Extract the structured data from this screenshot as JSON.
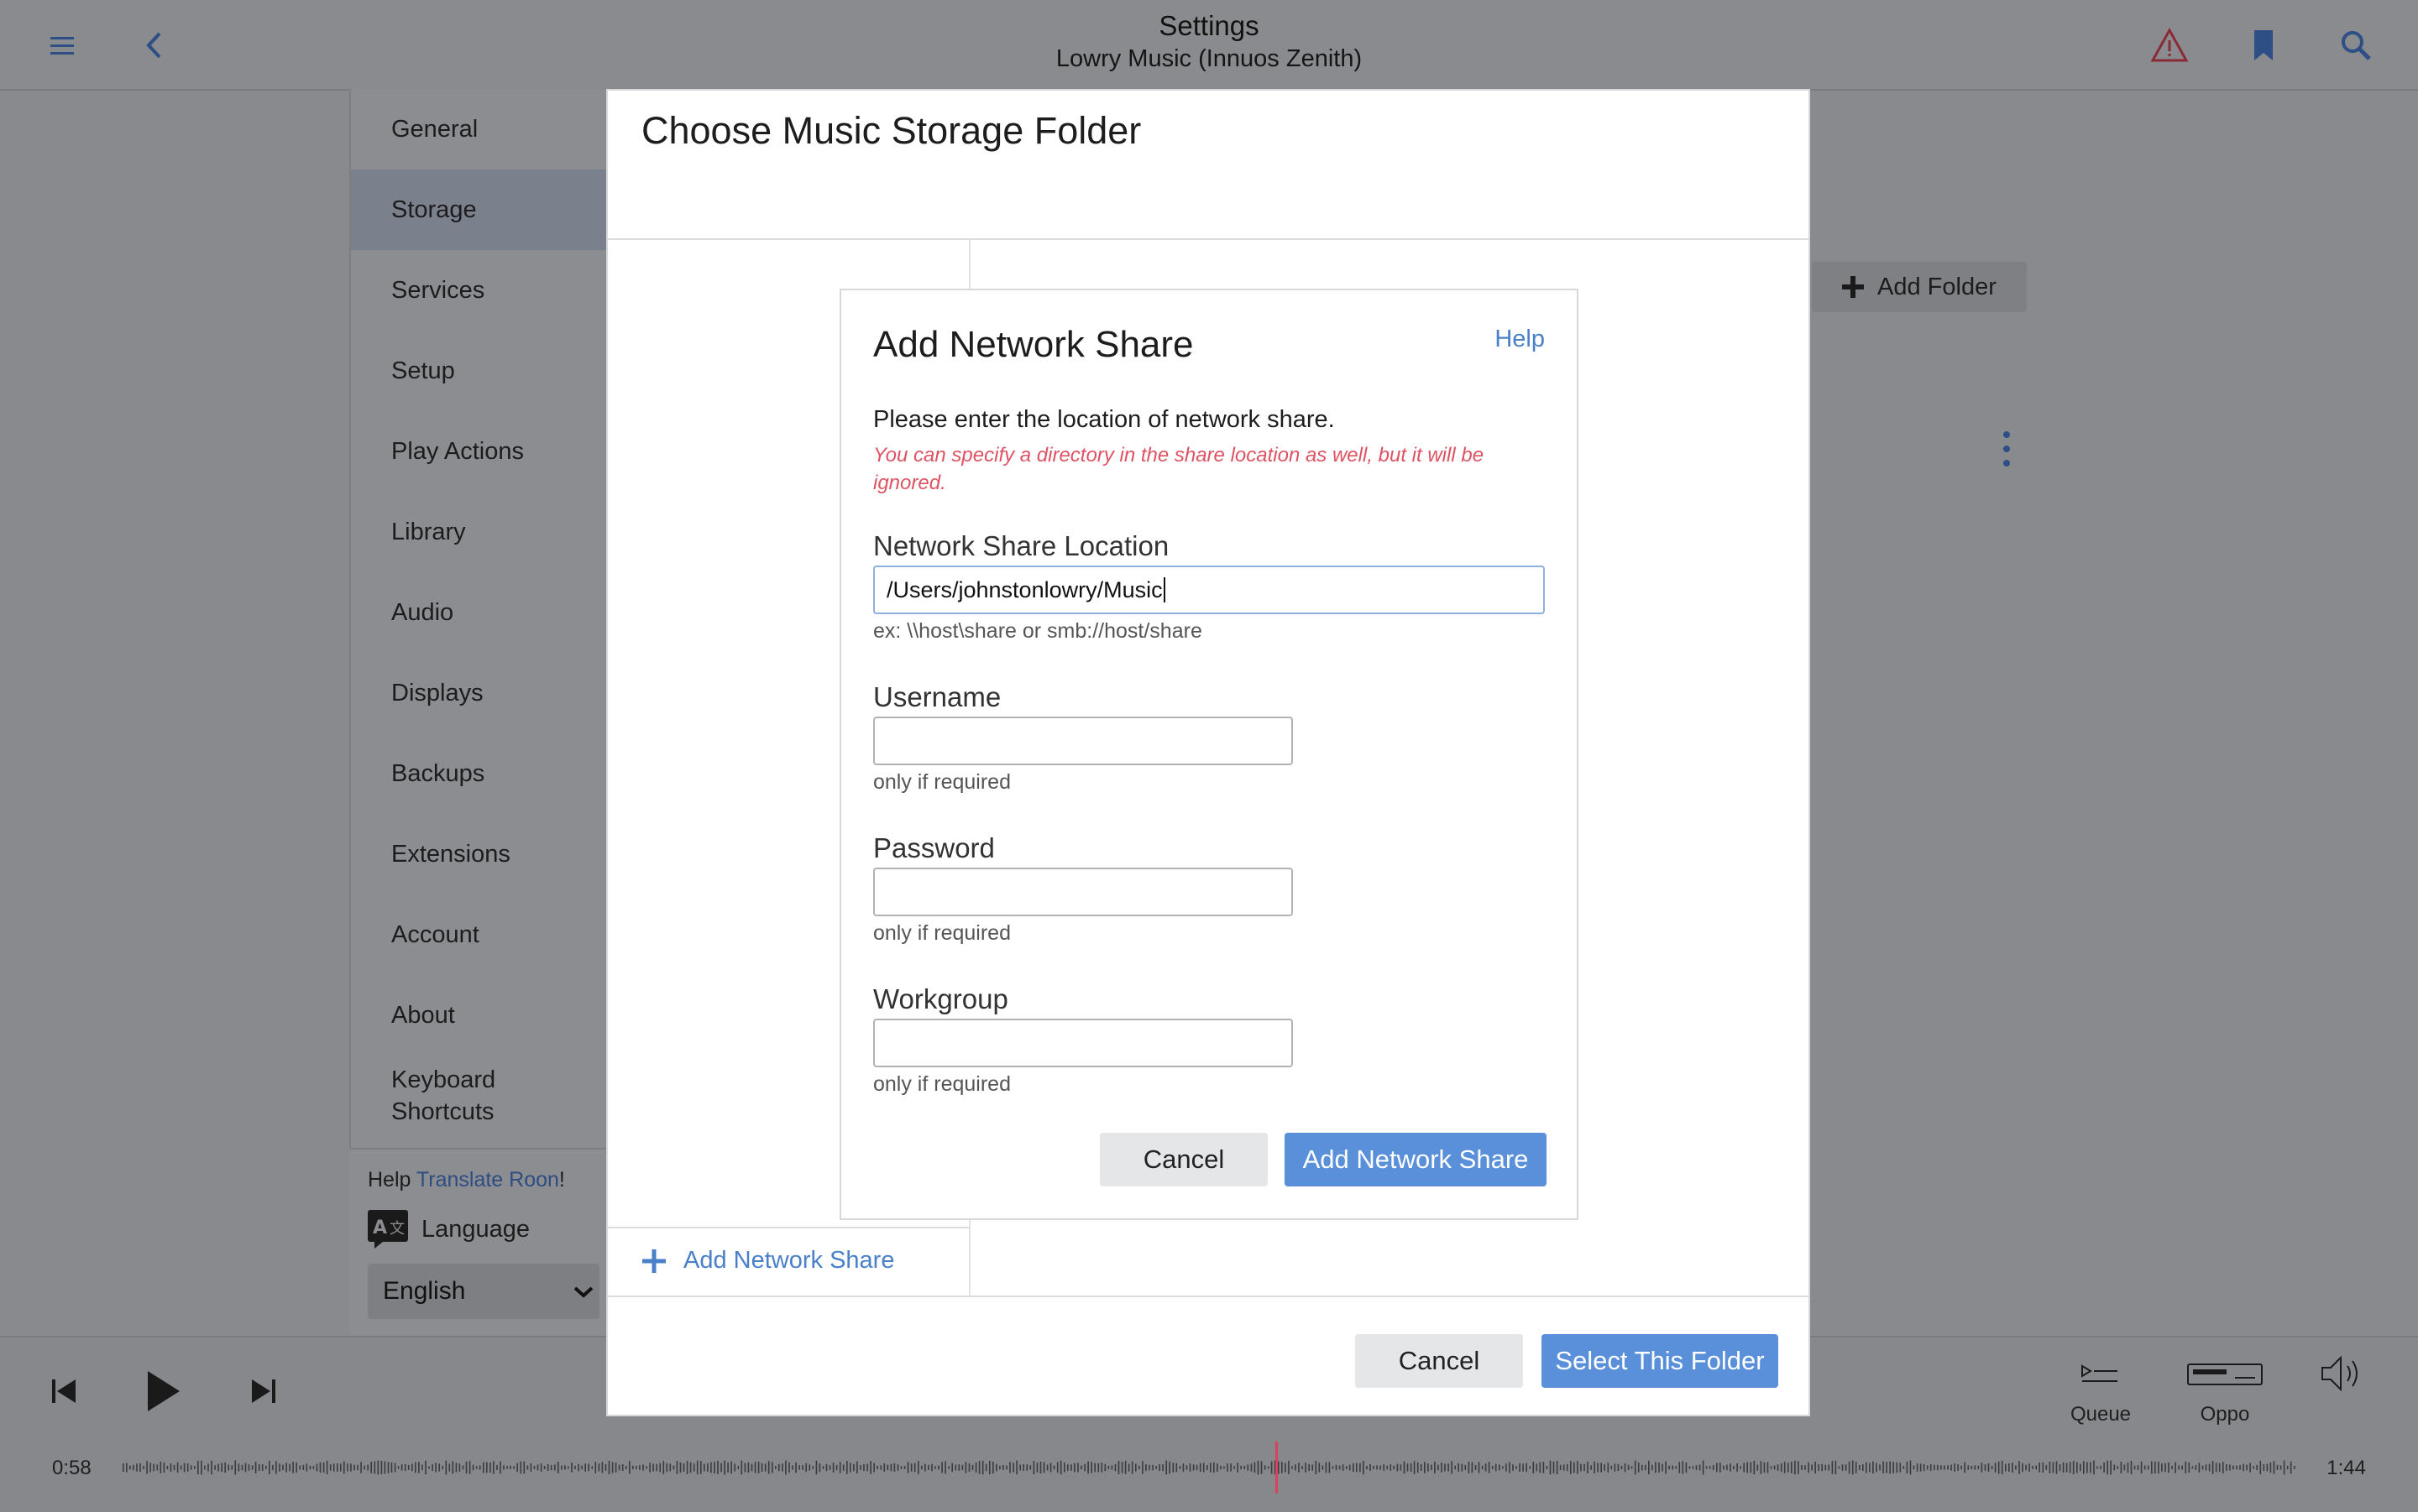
{
  "header": {
    "title": "Settings",
    "subtitle": "Lowry Music (Innuos Zenith)",
    "icons": [
      "menu-icon",
      "back-icon",
      "warning-icon",
      "bookmark-icon",
      "search-icon"
    ]
  },
  "sidebar": {
    "items": [
      {
        "label": "General"
      },
      {
        "label": "Storage",
        "active": true
      },
      {
        "label": "Services"
      },
      {
        "label": "Setup"
      },
      {
        "label": "Play Actions"
      },
      {
        "label": "Library"
      },
      {
        "label": "Audio"
      },
      {
        "label": "Displays"
      },
      {
        "label": "Backups"
      },
      {
        "label": "Extensions"
      },
      {
        "label": "Account"
      },
      {
        "label": "About"
      },
      {
        "label": "Keyboard Shortcuts"
      }
    ],
    "help_prefix": "Help ",
    "help_link": "Translate Roon",
    "help_suffix": "!",
    "language_label": "Language",
    "language_value": "English"
  },
  "storage": {
    "add_folder_label": "Add Folder"
  },
  "outer_dialog": {
    "title": "Choose Music Storage Folder",
    "add_network_share_label": "Add Network Share",
    "cancel_label": "Cancel",
    "select_label": "Select This Folder"
  },
  "inner_dialog": {
    "title": "Add Network Share",
    "help_label": "Help",
    "description": "Please enter the location of network share.",
    "note": "You can specify a directory in the share location as well, but it will be ignored.",
    "location": {
      "label": "Network Share Location",
      "value": "/Users/johnstonlowry/Music",
      "hint": "ex: \\\\host\\share or smb://host/share"
    },
    "username": {
      "label": "Username",
      "value": "",
      "hint": "only if required"
    },
    "password": {
      "label": "Password",
      "value": "",
      "hint": "only if required"
    },
    "workgroup": {
      "label": "Workgroup",
      "value": "",
      "hint": "only if required"
    },
    "cancel_label": "Cancel",
    "submit_label": "Add Network Share"
  },
  "player": {
    "elapsed": "0:58",
    "duration": "1:44",
    "progress": 0.53,
    "queue_label": "Queue",
    "zone_label": "Oppo",
    "colors": {
      "accent": "#5a90da",
      "progress_marker": "#d9445a"
    }
  }
}
